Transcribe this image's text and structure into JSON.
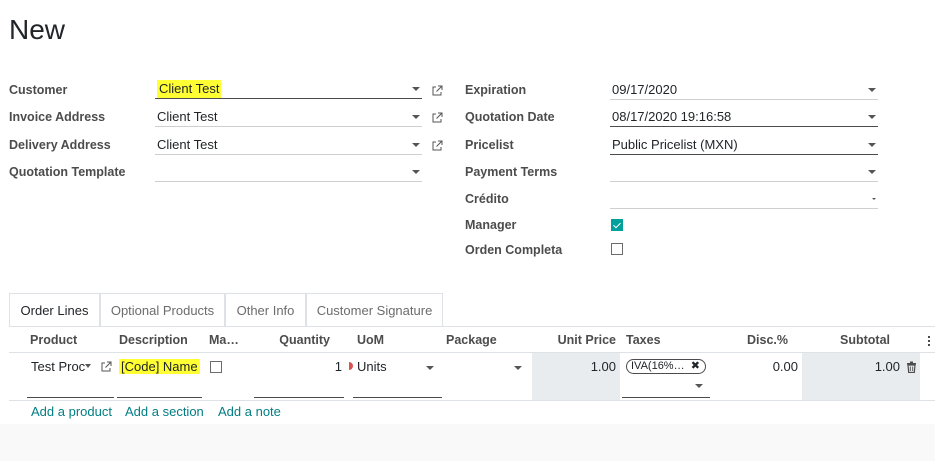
{
  "title": "New",
  "left_fields": [
    {
      "label": "Customer",
      "value": "Client Test"
    },
    {
      "label": "Invoice Address",
      "value": "Client Test"
    },
    {
      "label": "Delivery Address",
      "value": "Client Test"
    },
    {
      "label": "Quotation Template",
      "value": ""
    }
  ],
  "right_fields": [
    {
      "label": "Expiration",
      "value": "09/17/2020"
    },
    {
      "label": "Quotation Date",
      "value": "08/17/2020 19:16:58"
    },
    {
      "label": "Pricelist",
      "value": "Public Pricelist (MXN)"
    },
    {
      "label": "Payment Terms",
      "value": ""
    },
    {
      "label": "Crédito",
      "value": ""
    },
    {
      "label": "Manager",
      "checked": true
    },
    {
      "label": "Orden Completa",
      "checked": false
    }
  ],
  "tabs": [
    "Order Lines",
    "Optional Products",
    "Other Info",
    "Customer Signature"
  ],
  "table": {
    "headers": {
      "product": "Product",
      "description": "Description",
      "ma": "Ma…",
      "quantity": "Quantity",
      "uom": "UoM",
      "package": "Package",
      "unit_price": "Unit Price",
      "taxes": "Taxes",
      "disc": "Disc.%",
      "subtotal": "Subtotal"
    },
    "row": {
      "product": "Test Proc",
      "description": "[Code] Name",
      "ma_checked": false,
      "quantity": "1",
      "uom": "Units",
      "package": "",
      "unit_price": "1.00",
      "tax": "IVA(16%…",
      "disc": "0.00",
      "subtotal": "1.00"
    }
  },
  "links": {
    "add_product": "Add a product",
    "add_section": "Add a section",
    "add_note": "Add a note"
  },
  "colors": {
    "highlight": "#ffff33",
    "accent": "#00a09d",
    "link": "#017e84",
    "readonly_cell": "#e9ecef"
  },
  "icons": {
    "external": "external-link-icon",
    "dropdown": "caret-down-icon",
    "delete": "trash-icon",
    "options": "kebab-icon"
  }
}
